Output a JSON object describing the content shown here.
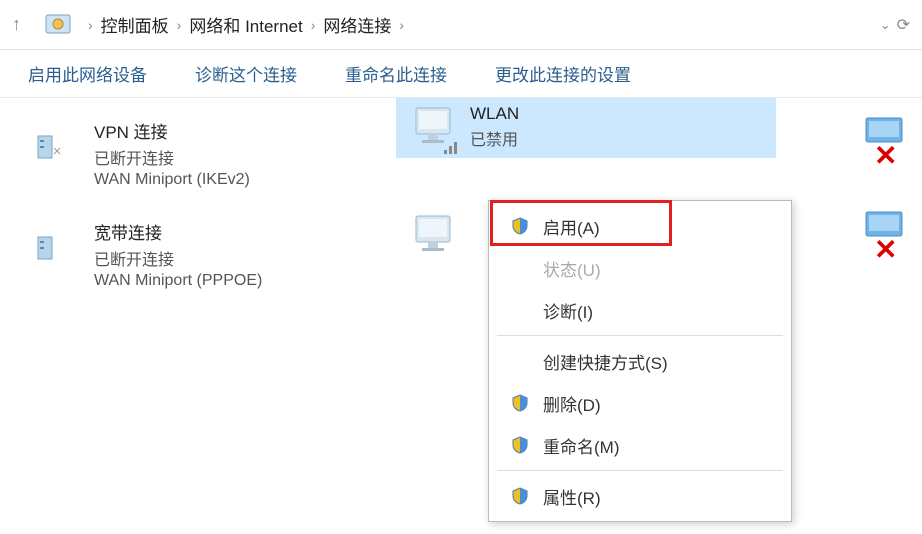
{
  "breadcrumb": {
    "items": [
      "控制面板",
      "网络和 Internet",
      "网络连接"
    ]
  },
  "toolbar": {
    "enable": "启用此网络设备",
    "diagnose": "诊断这个连接",
    "rename": "重命名此连接",
    "settings": "更改此连接的设置"
  },
  "adapters": [
    {
      "name": "VPN 连接",
      "status": "已断开连接",
      "device": "WAN Miniport (IKEv2)"
    },
    {
      "name": "宽带连接",
      "status": "已断开连接",
      "device": "WAN Miniport (PPPOE)"
    },
    {
      "name": "WLAN",
      "status": "已禁用",
      "device": ""
    },
    {
      "name": "",
      "status": "",
      "device": ""
    }
  ],
  "menu": {
    "enable": "启用(A)",
    "status": "状态(U)",
    "diagnose": "诊断(I)",
    "shortcut": "创建快捷方式(S)",
    "delete": "删除(D)",
    "rename": "重命名(M)",
    "properties": "属性(R)"
  }
}
